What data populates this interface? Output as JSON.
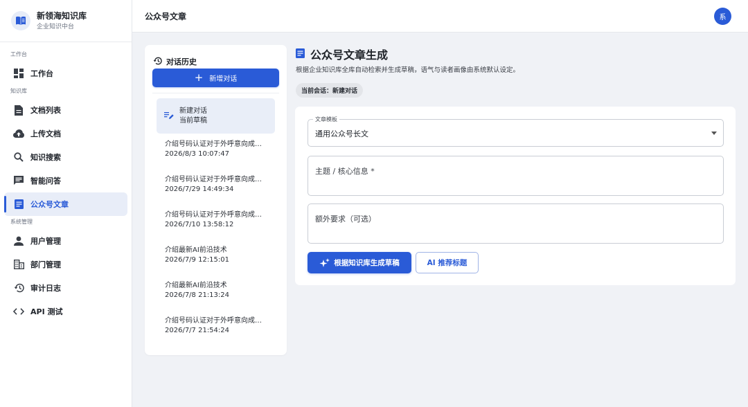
{
  "brand": {
    "title": "新领海知识库",
    "subtitle": "企业知识中台"
  },
  "sidebar": {
    "sections": [
      {
        "label": "工作台",
        "items": [
          {
            "label": "工作台",
            "icon": "dashboard-icon"
          }
        ]
      },
      {
        "label": "知识库",
        "items": [
          {
            "label": "文档列表",
            "icon": "document-icon"
          },
          {
            "label": "上传文档",
            "icon": "cloud-upload-icon"
          },
          {
            "label": "知识搜索",
            "icon": "search-icon"
          },
          {
            "label": "智能问答",
            "icon": "chat-icon"
          },
          {
            "label": "公众号文章",
            "icon": "article-icon",
            "active": true
          }
        ]
      },
      {
        "label": "系统管理",
        "items": [
          {
            "label": "用户管理",
            "icon": "user-icon"
          },
          {
            "label": "部门管理",
            "icon": "building-icon"
          },
          {
            "label": "审计日志",
            "icon": "history-icon"
          },
          {
            "label": "API 测试",
            "icon": "code-icon"
          }
        ]
      }
    ]
  },
  "header": {
    "title": "公众号文章",
    "avatar_text": "系"
  },
  "history": {
    "title": "对话历史",
    "new_button": "新增对话",
    "current": {
      "title": "新建对话",
      "subtitle": "当前草稿"
    },
    "items": [
      {
        "title": "介绍号码认证对于外呼意向成功率的提升",
        "time": "2026/8/3 10:07:47"
      },
      {
        "title": "介绍号码认证对于外呼意向成功率的提升",
        "time": "2026/7/29 14:49:34"
      },
      {
        "title": "介绍号码认证对于外呼意向成功率的提升",
        "time": "2026/7/10 13:58:12"
      },
      {
        "title": "介绍最新AI前沿技术",
        "time": "2026/7/9 12:15:01"
      },
      {
        "title": "介绍最新AI前沿技术",
        "time": "2026/7/8 21:13:24"
      },
      {
        "title": "介绍号码认证对于外呼意向成功率的提升",
        "time": "2026/7/7 21:54:24"
      }
    ]
  },
  "main": {
    "title": "公众号文章生成",
    "description": "根据企业知识库全库自动检索并生成草稿，语气与读者画像由系统默认设定。",
    "session_chip": "当前会话：新建对话",
    "template_label": "文章模板",
    "template_value": "通用公众号长文",
    "topic_placeholder": "主题 / 核心信息 *",
    "extra_placeholder": "额外要求（可选）",
    "generate_button": "根据知识库生成草稿",
    "title_button": "AI 推荐标题"
  },
  "colors": {
    "accent": "#2a5bd7",
    "active_bg": "#e8edf8",
    "page_bg": "#f0f2f6"
  }
}
